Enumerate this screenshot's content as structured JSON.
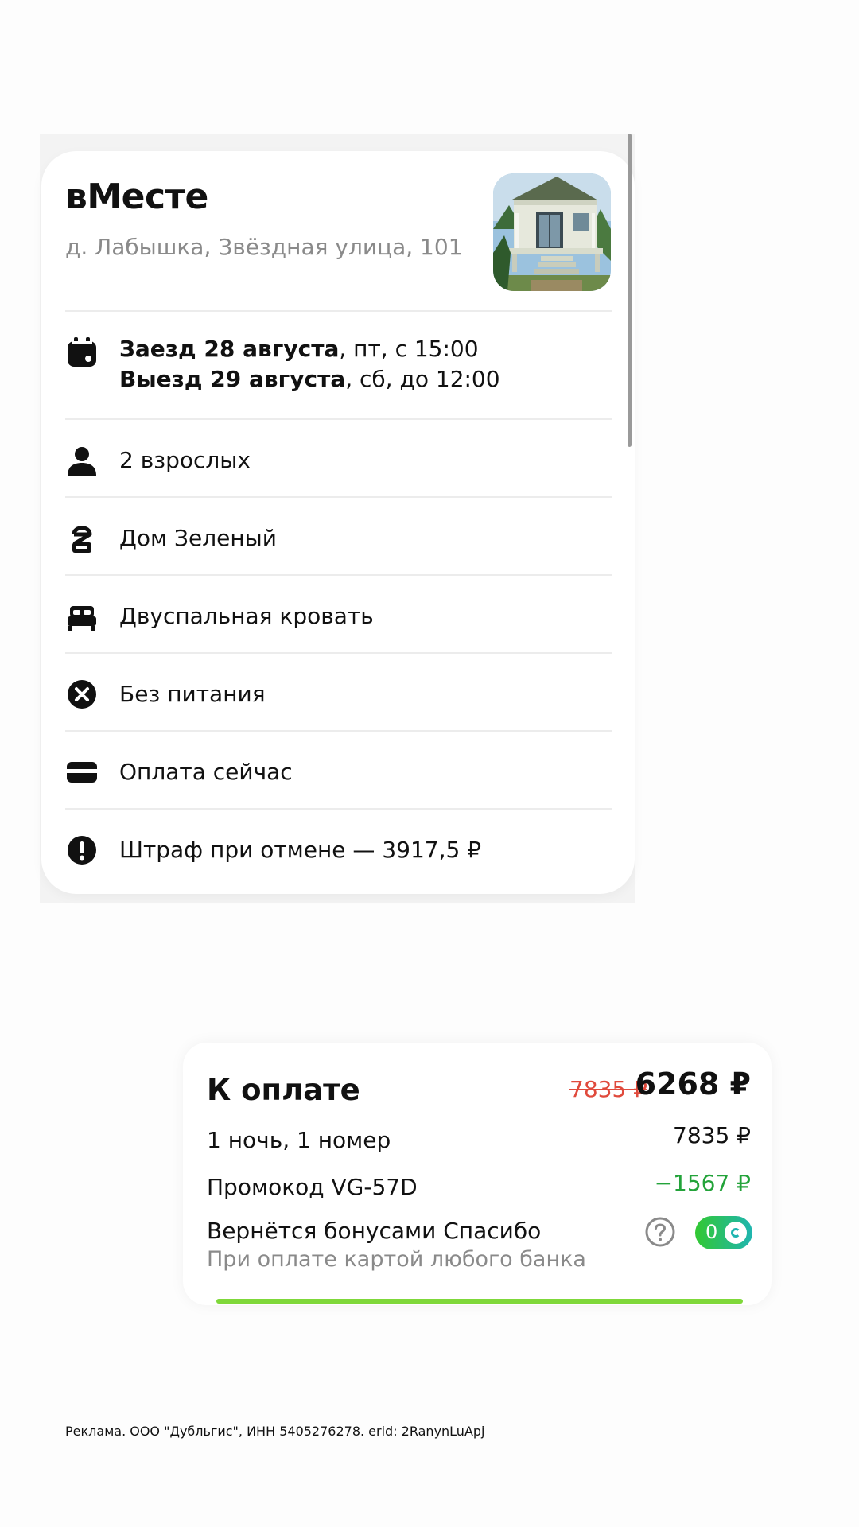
{
  "booking": {
    "hotel_name": "вМесте",
    "address": "д. Лабышка, Звёздная улица, 101",
    "photo_icon": "house-photo",
    "checkin_bold": "Заезд 28 августа",
    "checkin_rest": ", пт, с 15:00",
    "checkout_bold": "Выезд 29 августа",
    "checkout_rest": ", сб, до 12:00",
    "rows": [
      {
        "icon": "calendar-icon",
        "label": "dates"
      },
      {
        "icon": "person-icon",
        "label": "2 взрослых"
      },
      {
        "icon": "room-icon",
        "label": "Дом Зеленый"
      },
      {
        "icon": "bed-icon",
        "label": "Двуспальная кровать"
      },
      {
        "icon": "no-meal-icon",
        "label": "Без питания"
      },
      {
        "icon": "card-icon",
        "label": "Оплата сейчас"
      },
      {
        "icon": "warning-icon",
        "label": "Штраф при отмене — 3917,5 ₽"
      }
    ]
  },
  "payment": {
    "title": "К оплате",
    "old_price": "7835 ₽",
    "new_price": "6268 ₽",
    "nights_label": "1 ночь, 1 номер",
    "nights_value": "7835 ₽",
    "promo_label": "Промокод VG-57D",
    "promo_value": "−1567 ₽",
    "bonus_label": "Вернётся бонусами Спасибо",
    "bonus_sub": "При оплате картой любого банка",
    "bonus_count": "0",
    "progress_fraction": 1.0
  },
  "ad_note": "Реклама. ООО \"Дубльгис\", ИНН 5405276278. erid: 2RanynLuApj",
  "colors": {
    "discount_green": "#23a33a",
    "old_price_red": "#e04a3c",
    "toggle_gradient_start": "#32c832",
    "toggle_gradient_end": "#1fb5b0",
    "progress_green": "#7fd83a"
  }
}
